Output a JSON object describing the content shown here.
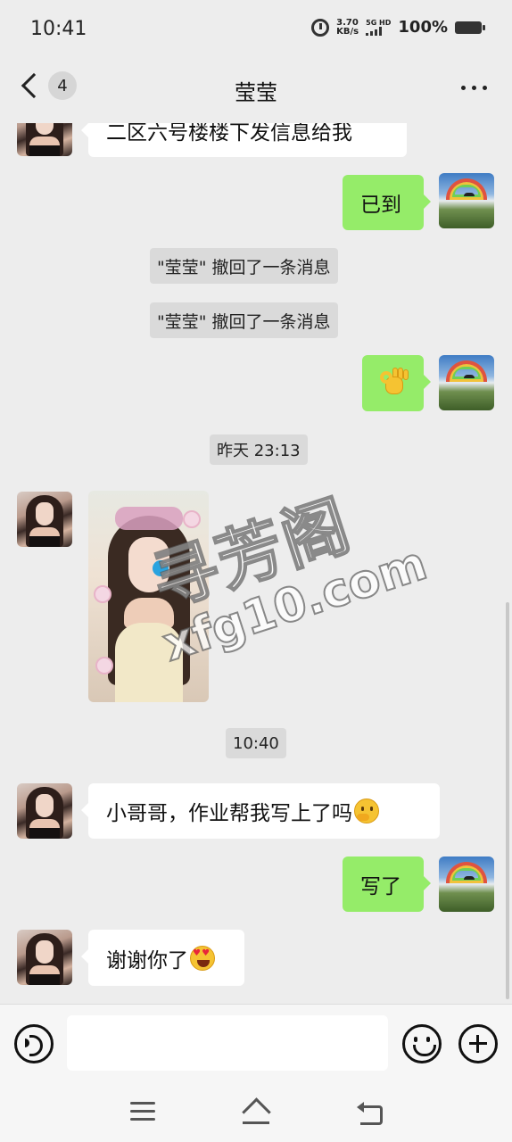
{
  "status_bar": {
    "time": "10:41",
    "net_speed_value": "3.70",
    "net_speed_unit": "KB/s",
    "signal_label": "5G HD",
    "battery": "100%"
  },
  "nav": {
    "unread_count": "4",
    "title": "莹莹"
  },
  "messages": {
    "m1_text": "二区六号楼楼下发信息给我",
    "m2_text": "已到",
    "recall_1": "\"莹莹\" 撤回了一条消息",
    "recall_2": "\"莹莹\" 撤回了一条消息",
    "time_1": "昨天 23:13",
    "time_2": "10:40",
    "m5_text": "小哥哥，作业帮我写上了吗",
    "m6_text": "写了",
    "m7_text": "谢谢你了"
  },
  "watermark": {
    "line1": "寻芳阁",
    "line2": "xfg10.com"
  },
  "input": {
    "placeholder": ""
  },
  "icons": {
    "ok_hand": "ok-hand-emoji",
    "thinking": "thinking-face-emoji",
    "heart_eyes": "heart-eyes-emoji"
  }
}
